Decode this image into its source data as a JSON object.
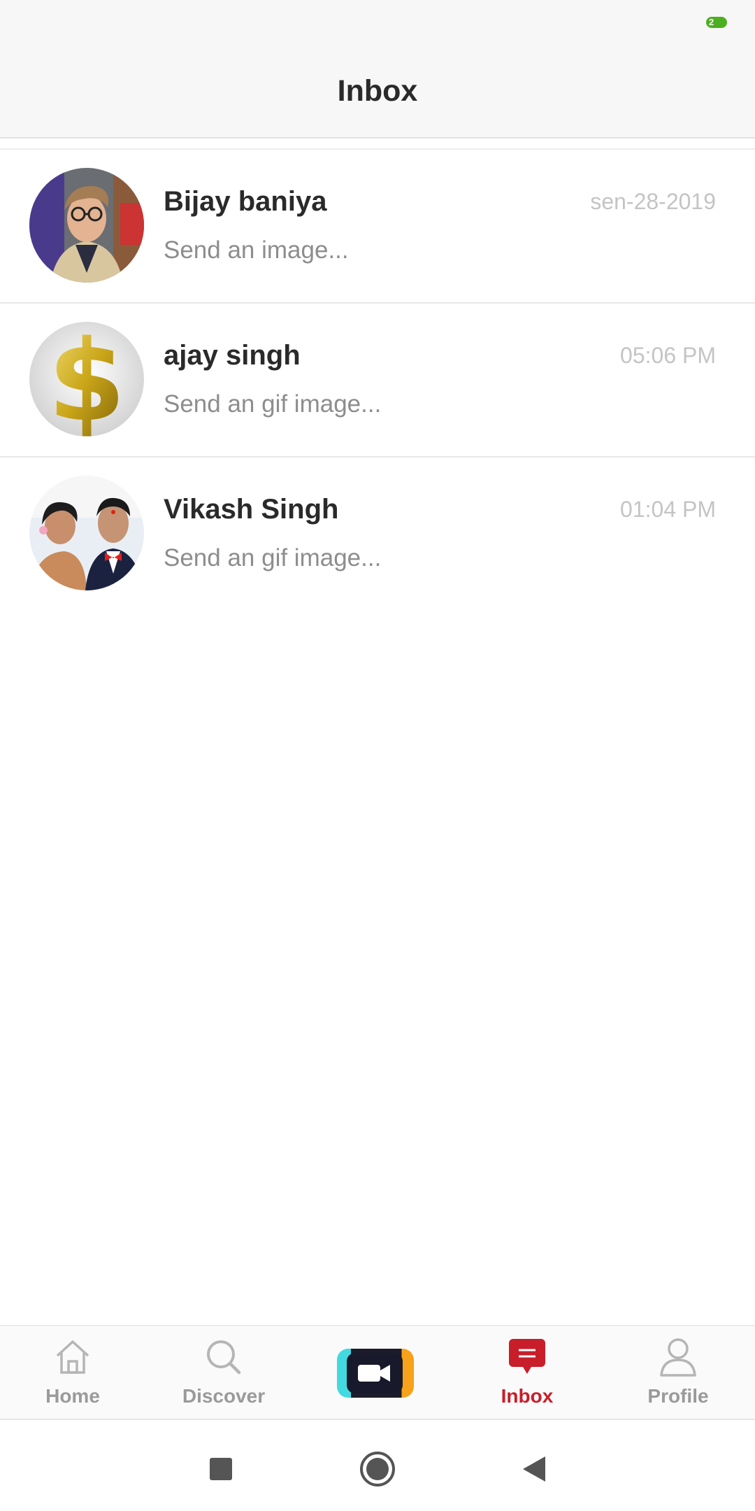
{
  "status_bar": {
    "battery_text": "2"
  },
  "header": {
    "title": "Inbox"
  },
  "chats": [
    {
      "name": "Bijay baniya",
      "preview": "Send an image...",
      "time": "sen-28-2019",
      "avatar": "photo-avatar-young-man"
    },
    {
      "name": "ajay singh",
      "preview": "Send an gif image...",
      "time": "05:06 PM",
      "avatar": "gold-dollar-sign-avatar"
    },
    {
      "name": "Vikash Singh",
      "preview": "Send an gif image...",
      "time": "01:04 PM",
      "avatar": "couple-photo-avatar"
    }
  ],
  "bottom_nav": {
    "items": [
      {
        "label": "Home",
        "icon": "home-icon",
        "active": false
      },
      {
        "label": "Discover",
        "icon": "search-icon",
        "active": false
      },
      {
        "label": "",
        "icon": "video-camera-icon",
        "active": false
      },
      {
        "label": "Inbox",
        "icon": "message-icon",
        "active": true
      },
      {
        "label": "Profile",
        "icon": "person-icon",
        "active": false
      }
    ]
  },
  "colors": {
    "accent": "#c81e2a",
    "inactive": "#9a9a9a",
    "timestamp": "#c4c4c4"
  },
  "system_nav": {
    "buttons": [
      "recents-square-icon",
      "home-circle-icon",
      "back-triangle-icon"
    ]
  }
}
